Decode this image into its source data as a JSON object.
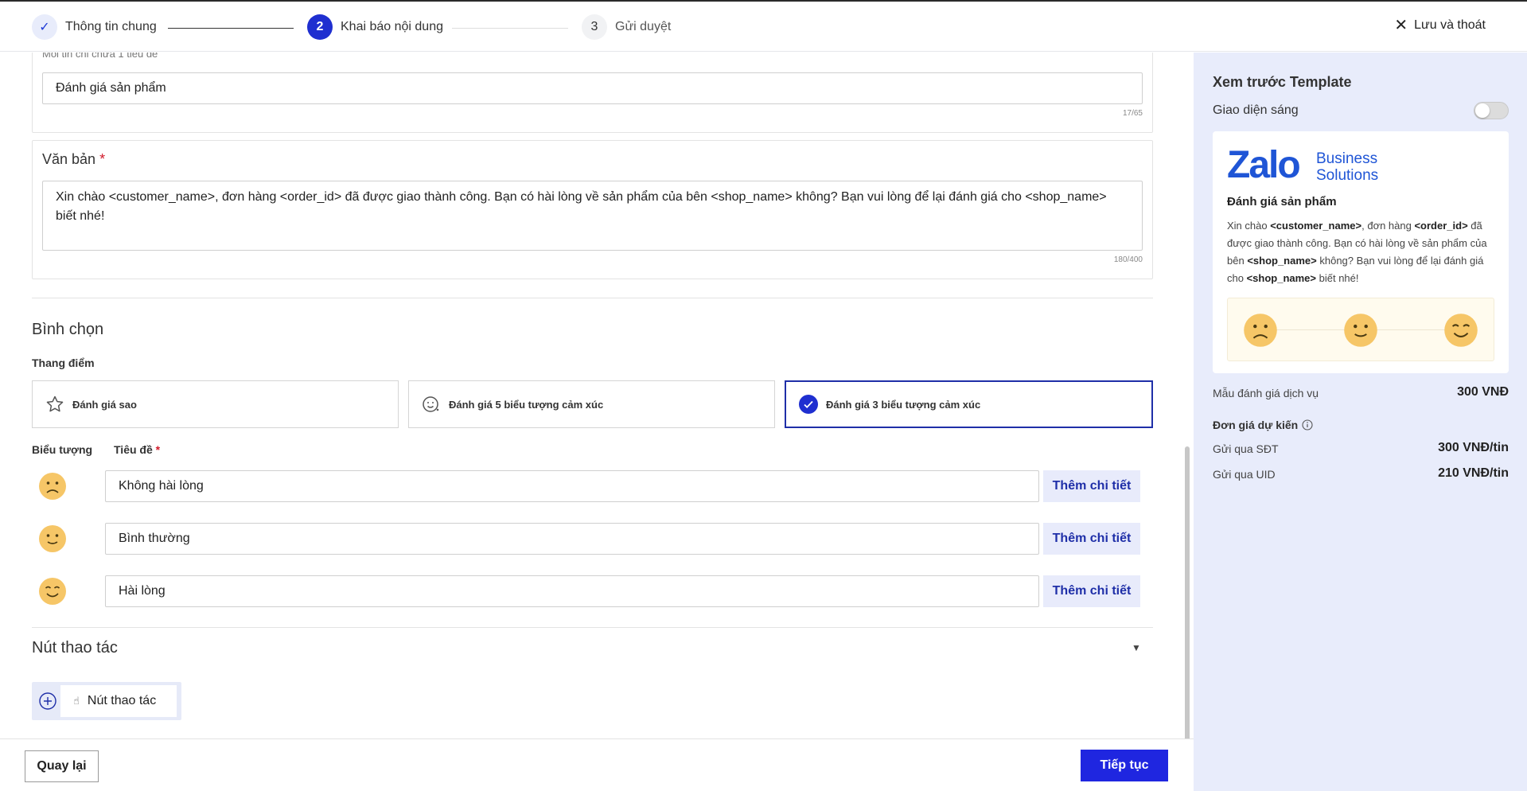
{
  "stepper": {
    "steps": [
      {
        "label": "Thông tin chung",
        "number": "✓"
      },
      {
        "label": "Khai báo nội dung",
        "number": "2"
      },
      {
        "label": "Gửi duyệt",
        "number": "3"
      }
    ],
    "exit_label": "Lưu và thoát"
  },
  "title_card": {
    "hint": "Mỗi tin chỉ chứa 1 tiêu đề",
    "value": "Đánh giá sản phẩm",
    "counter": "17/65"
  },
  "text_card": {
    "label": "Văn bản",
    "required": "*",
    "value": "Xin chào <customer_name>, đơn hàng <order_id> đã được giao thành công. Bạn có hài lòng về sản phẩm của bên <shop_name> không? Bạn vui lòng để lại đánh giá cho <shop_name> biết nhé!",
    "counter": "180/400"
  },
  "poll": {
    "title": "Bình chọn",
    "scale_label": "Thang điểm",
    "options": [
      {
        "label": "Đánh giá sao",
        "icon": "star-icon"
      },
      {
        "label": "Đánh giá 5 biểu tượng cảm xúc",
        "icon": "emoji-icon"
      },
      {
        "label": "Đánh giá 3 biểu tượng cảm xúc",
        "icon": "check-circle-icon",
        "selected": true
      }
    ],
    "col_icon": "Biểu tượng",
    "col_title": "Tiêu đề",
    "required": "*",
    "rows": [
      {
        "title": "Không hài lòng",
        "emoji": "sad-face-icon",
        "detail": "Thêm chi tiết"
      },
      {
        "title": "Bình thường",
        "emoji": "neutral-face-icon",
        "detail": "Thêm chi tiết"
      },
      {
        "title": "Hài lòng",
        "emoji": "happy-face-icon",
        "detail": "Thêm chi tiết"
      }
    ]
  },
  "actions": {
    "title": "Nút thao tác",
    "button_label": "Nút thao tác"
  },
  "footer": {
    "back": "Quay lại",
    "next": "Tiếp tục"
  },
  "preview": {
    "title": "Xem trước Template",
    "light_mode_label": "Giao diện sáng",
    "light_mode_on": false,
    "logo_word": "Zalo",
    "logo_line1": "Business",
    "logo_line2": "Solutions",
    "card_title": "Đánh giá sản phẩm",
    "body": {
      "t1": "Xin chào ",
      "b1": "<customer_name>",
      "t2": ", đơn hàng ",
      "b2": "<order_id>",
      "t3": " đã được giao thành công. Bạn có hài lòng về sản phẩm của bên ",
      "b3": "<shop_name>",
      "t4": " không? Bạn vui lòng để lại đánh giá cho ",
      "b4": "<shop_name>",
      "t5": " biết nhé!"
    },
    "pricing": {
      "service_label": "Mẫu đánh giá dịch vụ",
      "service_value": "300 VNĐ",
      "unit_price_label": "Đơn giá dự kiến",
      "sdt_label": "Gửi qua SĐT",
      "sdt_value": "300 VNĐ/tin",
      "uid_label": "Gửi qua UID",
      "uid_value": "210 VNĐ/tin"
    }
  },
  "colors": {
    "primary": "#1f2fd0",
    "primary_button": "#1f26e0",
    "accent_bg": "#e8ecfb",
    "required": "#d11a2a",
    "emoji": "#f6c667"
  }
}
